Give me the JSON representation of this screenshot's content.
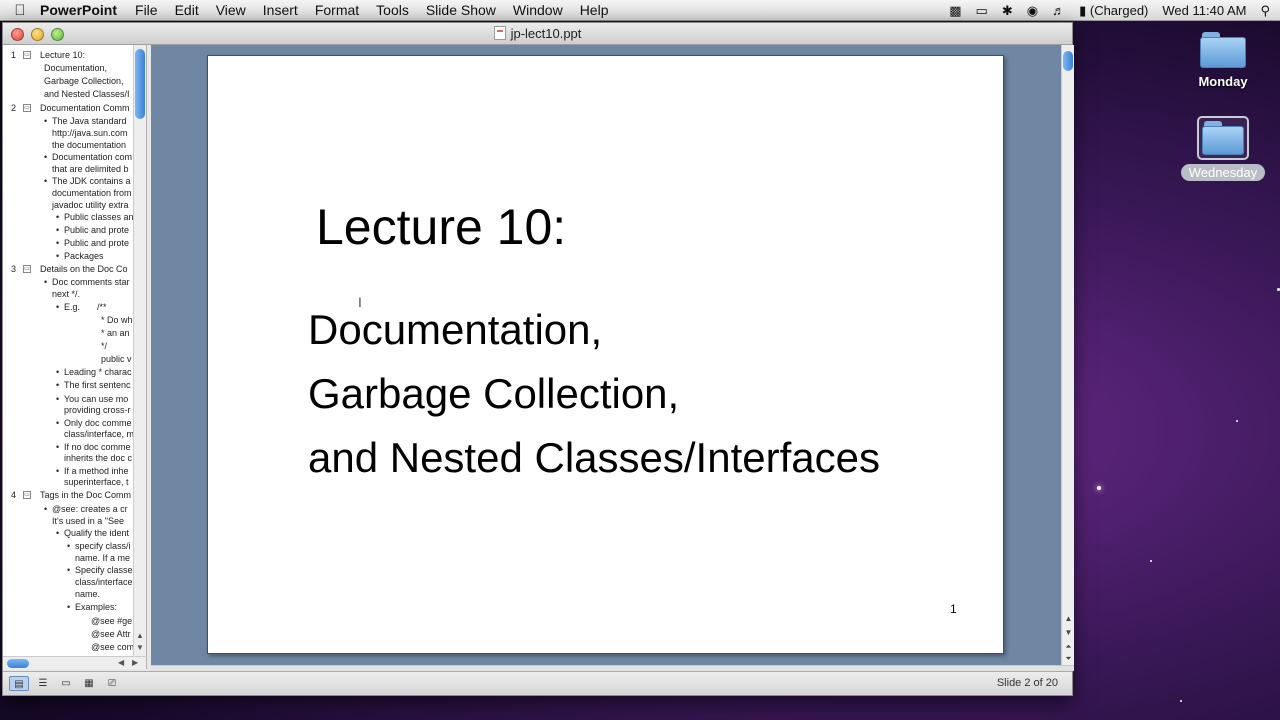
{
  "menubar": {
    "app_name": "PowerPoint",
    "items": [
      "File",
      "Edit",
      "View",
      "Insert",
      "Format",
      "Tools",
      "Slide Show",
      "Window",
      "Help"
    ],
    "battery": "(Charged)",
    "clock": "Wed 11:40 AM"
  },
  "window": {
    "title": "jp-lect10.ppt"
  },
  "outline": {
    "rows": [
      {
        "num": "1",
        "text": "Lecture 10:"
      },
      {
        "text": "Documentation,"
      },
      {
        "text": "Garbage Collection,"
      },
      {
        "text": "and Nested Classes/I"
      },
      {
        "num": "2",
        "text": "Documentation Comm"
      },
      {
        "text": "The Java standard"
      },
      {
        "text": "http://java.sun.com"
      },
      {
        "text": "the documentation"
      },
      {
        "text": "Documentation com"
      },
      {
        "text": "that are delimited b"
      },
      {
        "text": "The JDK contains a"
      },
      {
        "text": "documentation from"
      },
      {
        "text": "javadoc utility extra"
      },
      {
        "text": "Public classes an"
      },
      {
        "text": "Public and prote"
      },
      {
        "text": "Public and prote"
      },
      {
        "text": "Packages"
      },
      {
        "num": "3",
        "text": "Details on the Doc Co"
      },
      {
        "text": "Doc comments star"
      },
      {
        "text": "next */."
      },
      {
        "text": "E.g."
      },
      {
        "text": "/**"
      },
      {
        "text": "* Do wh"
      },
      {
        "text": "* an an"
      },
      {
        "text": "*/"
      },
      {
        "text": "public v"
      },
      {
        "text": "Leading * charac"
      },
      {
        "text": "The first sentenc"
      },
      {
        "text": "You can use mo"
      },
      {
        "text": "providing cross-r"
      },
      {
        "text": "Only doc comme"
      },
      {
        "text": "class/interface, m"
      },
      {
        "text": "If no doc comme"
      },
      {
        "text": "inherits the doc c"
      },
      {
        "text": "If a method inhe"
      },
      {
        "text": "superinterface, t"
      },
      {
        "num": "4",
        "text": "Tags in the Doc Comm"
      },
      {
        "text": "@see: creates a cr"
      },
      {
        "text": "It's used in a \"See"
      },
      {
        "text": "Qualify the ident"
      },
      {
        "text": "specify class/i"
      },
      {
        "text": "name. If a me"
      },
      {
        "text": "Specify classe"
      },
      {
        "text": "class/interface"
      },
      {
        "text": "name."
      },
      {
        "text": "Examples:"
      },
      {
        "text": "@see #ge"
      },
      {
        "text": "@see Attr"
      },
      {
        "text": "@see com"
      }
    ]
  },
  "slide": {
    "title": "Lecture 10:",
    "lines": [
      "Documentation,",
      "Garbage Collection,",
      "and Nested Classes/Interfaces"
    ],
    "number": "1"
  },
  "status": {
    "slide_count": "Slide 2 of 20"
  },
  "desktop": {
    "icons": [
      "Monday",
      "Wednesday"
    ]
  }
}
